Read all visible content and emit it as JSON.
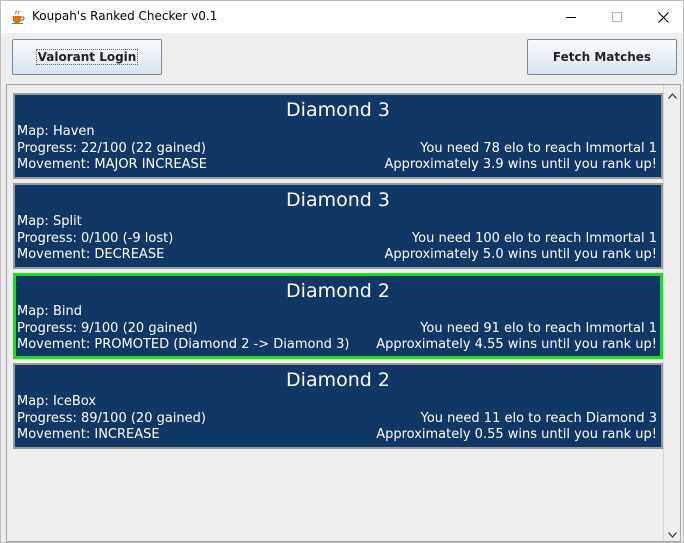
{
  "window": {
    "title": "Koupah's Ranked Checker v0.1"
  },
  "toolbar": {
    "login_label": "Valorant Login",
    "fetch_label": "Fetch Matches"
  },
  "matches": [
    {
      "rank": "Diamond 3",
      "map": "Map: Haven",
      "progress": "Progress: 22/100 (22 gained)",
      "movement": "Movement: MAJOR INCREASE",
      "elo_needed": "You need 78 elo to reach Immortal 1",
      "wins_until": "Approximately 3.9 wins until you rank up!"
    },
    {
      "rank": "Diamond 3",
      "map": "Map: Split",
      "progress": "Progress: 0/100 (-9 lost)",
      "movement": "Movement: DECREASE",
      "elo_needed": "You need 100 elo to reach Immortal 1",
      "wins_until": "Approximately 5.0 wins until you rank up!"
    },
    {
      "rank": "Diamond 2",
      "map": "Map: Bind",
      "progress": "Progress: 9/100 (20 gained)",
      "movement": "Movement: PROMOTED (Diamond 2 -> Diamond 3)",
      "elo_needed": "You need 91 elo to reach Immortal 1",
      "wins_until": "Approximately 4.55 wins until you rank up!"
    },
    {
      "rank": "Diamond 2",
      "map": "Map: IceBox",
      "progress": "Progress: 89/100 (20 gained)",
      "movement": "Movement: INCREASE",
      "elo_needed": "You need 11 elo to reach Diamond 3",
      "wins_until": "Approximately 0.55 wins until you rank up!"
    }
  ],
  "colors": {
    "card_background": "#0f3866",
    "card_border": "#9a9a9a",
    "selected_border": "#19e019"
  },
  "icons": {
    "app": "java-coffee-cup-icon",
    "minimize": "minimize-icon",
    "maximize": "maximize-icon",
    "close": "close-icon"
  }
}
